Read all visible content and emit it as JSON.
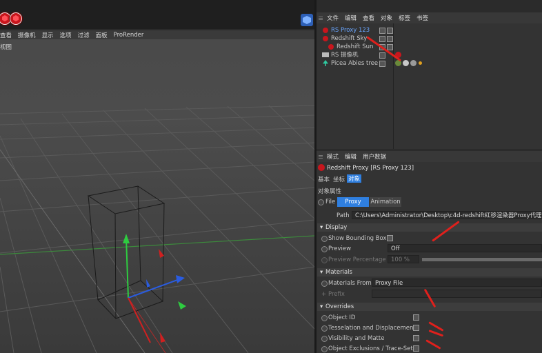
{
  "left_menu": [
    "查看",
    "摄像机",
    "显示",
    "选项",
    "过滤",
    "面板",
    "ProRender"
  ],
  "viewport_label": "视图",
  "object_manager": {
    "menu": [
      "文件",
      "编辑",
      "查看",
      "对象",
      "标签",
      "书签"
    ],
    "objects": [
      {
        "name": "RS Proxy 123",
        "selected": true
      },
      {
        "name": "Redshift Sky",
        "selected": false
      },
      {
        "name": "Redshift Sun",
        "selected": false
      },
      {
        "name": "RS 摄像机",
        "selected": false
      },
      {
        "name": "Picea Abies tree",
        "selected": false
      }
    ]
  },
  "attributes": {
    "menu": [
      "模式",
      "编辑",
      "用户数据"
    ],
    "title": "Redshift Proxy [RS Proxy 123]",
    "tabs": [
      "基本",
      "坐标",
      "对象"
    ],
    "active_tab": "对象",
    "group_label": "对象属性",
    "file_label": "File",
    "subtabs": [
      "Proxy",
      "Animation"
    ],
    "path_label": "Path",
    "path_value": "C:\\Users\\Administrator\\Desktop\\c4d-redshift红移渲染器Proxy代理的使",
    "display_section": "Display",
    "show_bbox_label": "Show Bounding Box",
    "preview_label": "Preview",
    "preview_value": "Off",
    "preview_pct_label": "Preview Percentage",
    "preview_pct_value": "100 %",
    "materials_section": "Materials",
    "materials_from_label": "Materials From",
    "materials_from_value": "Proxy File",
    "prefix_label": "Prefix",
    "overrides_section": "Overrides",
    "overrides": [
      "Object ID",
      "Tesselation and Displacement",
      "Visibility and Matte",
      "Object Exclusions / Trace-Sets"
    ]
  },
  "colors": {
    "accent": "#2f7fe0",
    "arrow": "#e0201c",
    "selected_text": "#6aa6ff"
  }
}
